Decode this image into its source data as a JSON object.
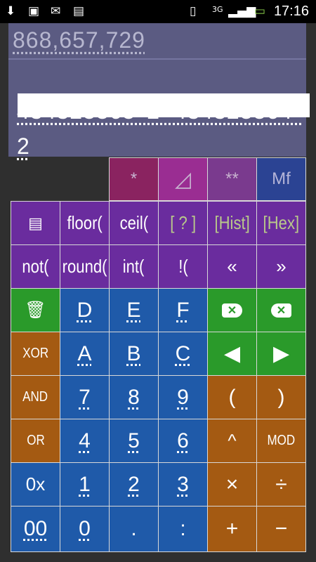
{
  "status_bar": {
    "time": "17:16",
    "net_label": "3G",
    "icons": [
      "download-icon",
      "image-icon",
      "gmail-icon",
      "bag-icon",
      "vibrate-icon",
      "signal-icon",
      "battery-icon"
    ]
  },
  "display": {
    "result": "868,657,729",
    "expression": "434328865^2−434328864^2"
  },
  "keys": {
    "row1": [
      "*",
      "◿",
      "**",
      "Mf"
    ],
    "row2": [
      "",
      "floor(",
      "ceil(",
      "[ ? ]",
      "[Hist]",
      "[Hex]"
    ],
    "row3": [
      "not(",
      "round(",
      "int(",
      "!(",
      "«",
      "»"
    ],
    "row4": [
      "",
      "D",
      "E",
      "F",
      "",
      ""
    ],
    "row5": [
      "XOR",
      "A",
      "B",
      "C",
      "◀",
      "▶"
    ],
    "row6": [
      "AND",
      "7",
      "8",
      "9",
      "(",
      ")"
    ],
    "row7": [
      "OR",
      "4",
      "5",
      "6",
      "^",
      "MOD"
    ],
    "row8": [
      "0x",
      "1",
      "2",
      "3",
      "×",
      "÷"
    ],
    "row9": [
      "00",
      "0",
      ".",
      ":",
      "+",
      "−"
    ]
  },
  "colors": {
    "display_bg": "#5b5b82",
    "purple": "#6a2c9e",
    "blue": "#1f5aa9",
    "green": "#2a9a2a",
    "orange": "#a45a12"
  }
}
